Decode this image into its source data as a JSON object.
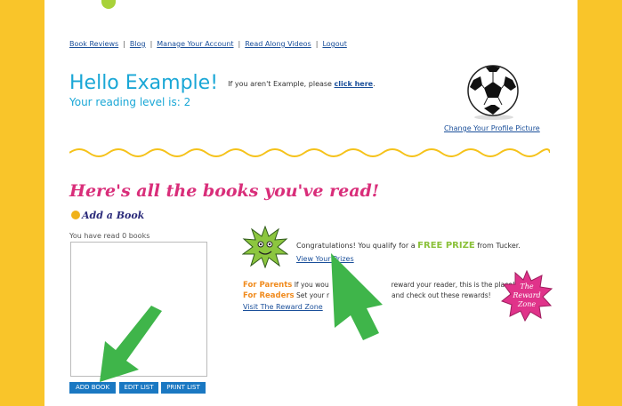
{
  "colors": {
    "side": "#f9c52a",
    "accent": "#1aa7d6",
    "heading": "#d92e7a",
    "button": "#1a78c2",
    "arrow": "#3fb54a"
  },
  "nav": {
    "items": [
      "Book Reviews",
      "Blog",
      "Manage Your Account",
      "Read Along Videos",
      "Logout"
    ],
    "separator": "|"
  },
  "greeting": {
    "hello": "Hello Example!",
    "notice": "If you aren't Example, please",
    "link": "click here",
    "link_suffix": "."
  },
  "reading_level": "Your reading level is: 2",
  "profile": {
    "change_picture": "Change Your Profile Picture",
    "avatar_icon": "soccer-ball-icon"
  },
  "books": {
    "heading": "Here's all the books you've read!",
    "add_book": "Add a Book",
    "count_text": "You have read 0 books"
  },
  "buttons": {
    "add": "ADD BOOK",
    "edit": "EDIT LIST",
    "print": "PRINT LIST"
  },
  "rewards": {
    "congrats_prefix": "Congratulations! You qualify for a",
    "free_prize": "FREE PRIZE",
    "congrats_suffix": "from Tucker.",
    "view_prizes": "View Your Prizes",
    "parents_label": "For Parents",
    "parents_text_a": "If you wou",
    "parents_text_b": "reward your reader, this is the place!",
    "readers_label": "For Readers",
    "readers_text_a": "Set your r",
    "readers_text_b": "and check out these rewards!",
    "visit": "Visit The Reward Zone",
    "badge_lines": [
      "The",
      "Reward",
      "Zone"
    ]
  }
}
